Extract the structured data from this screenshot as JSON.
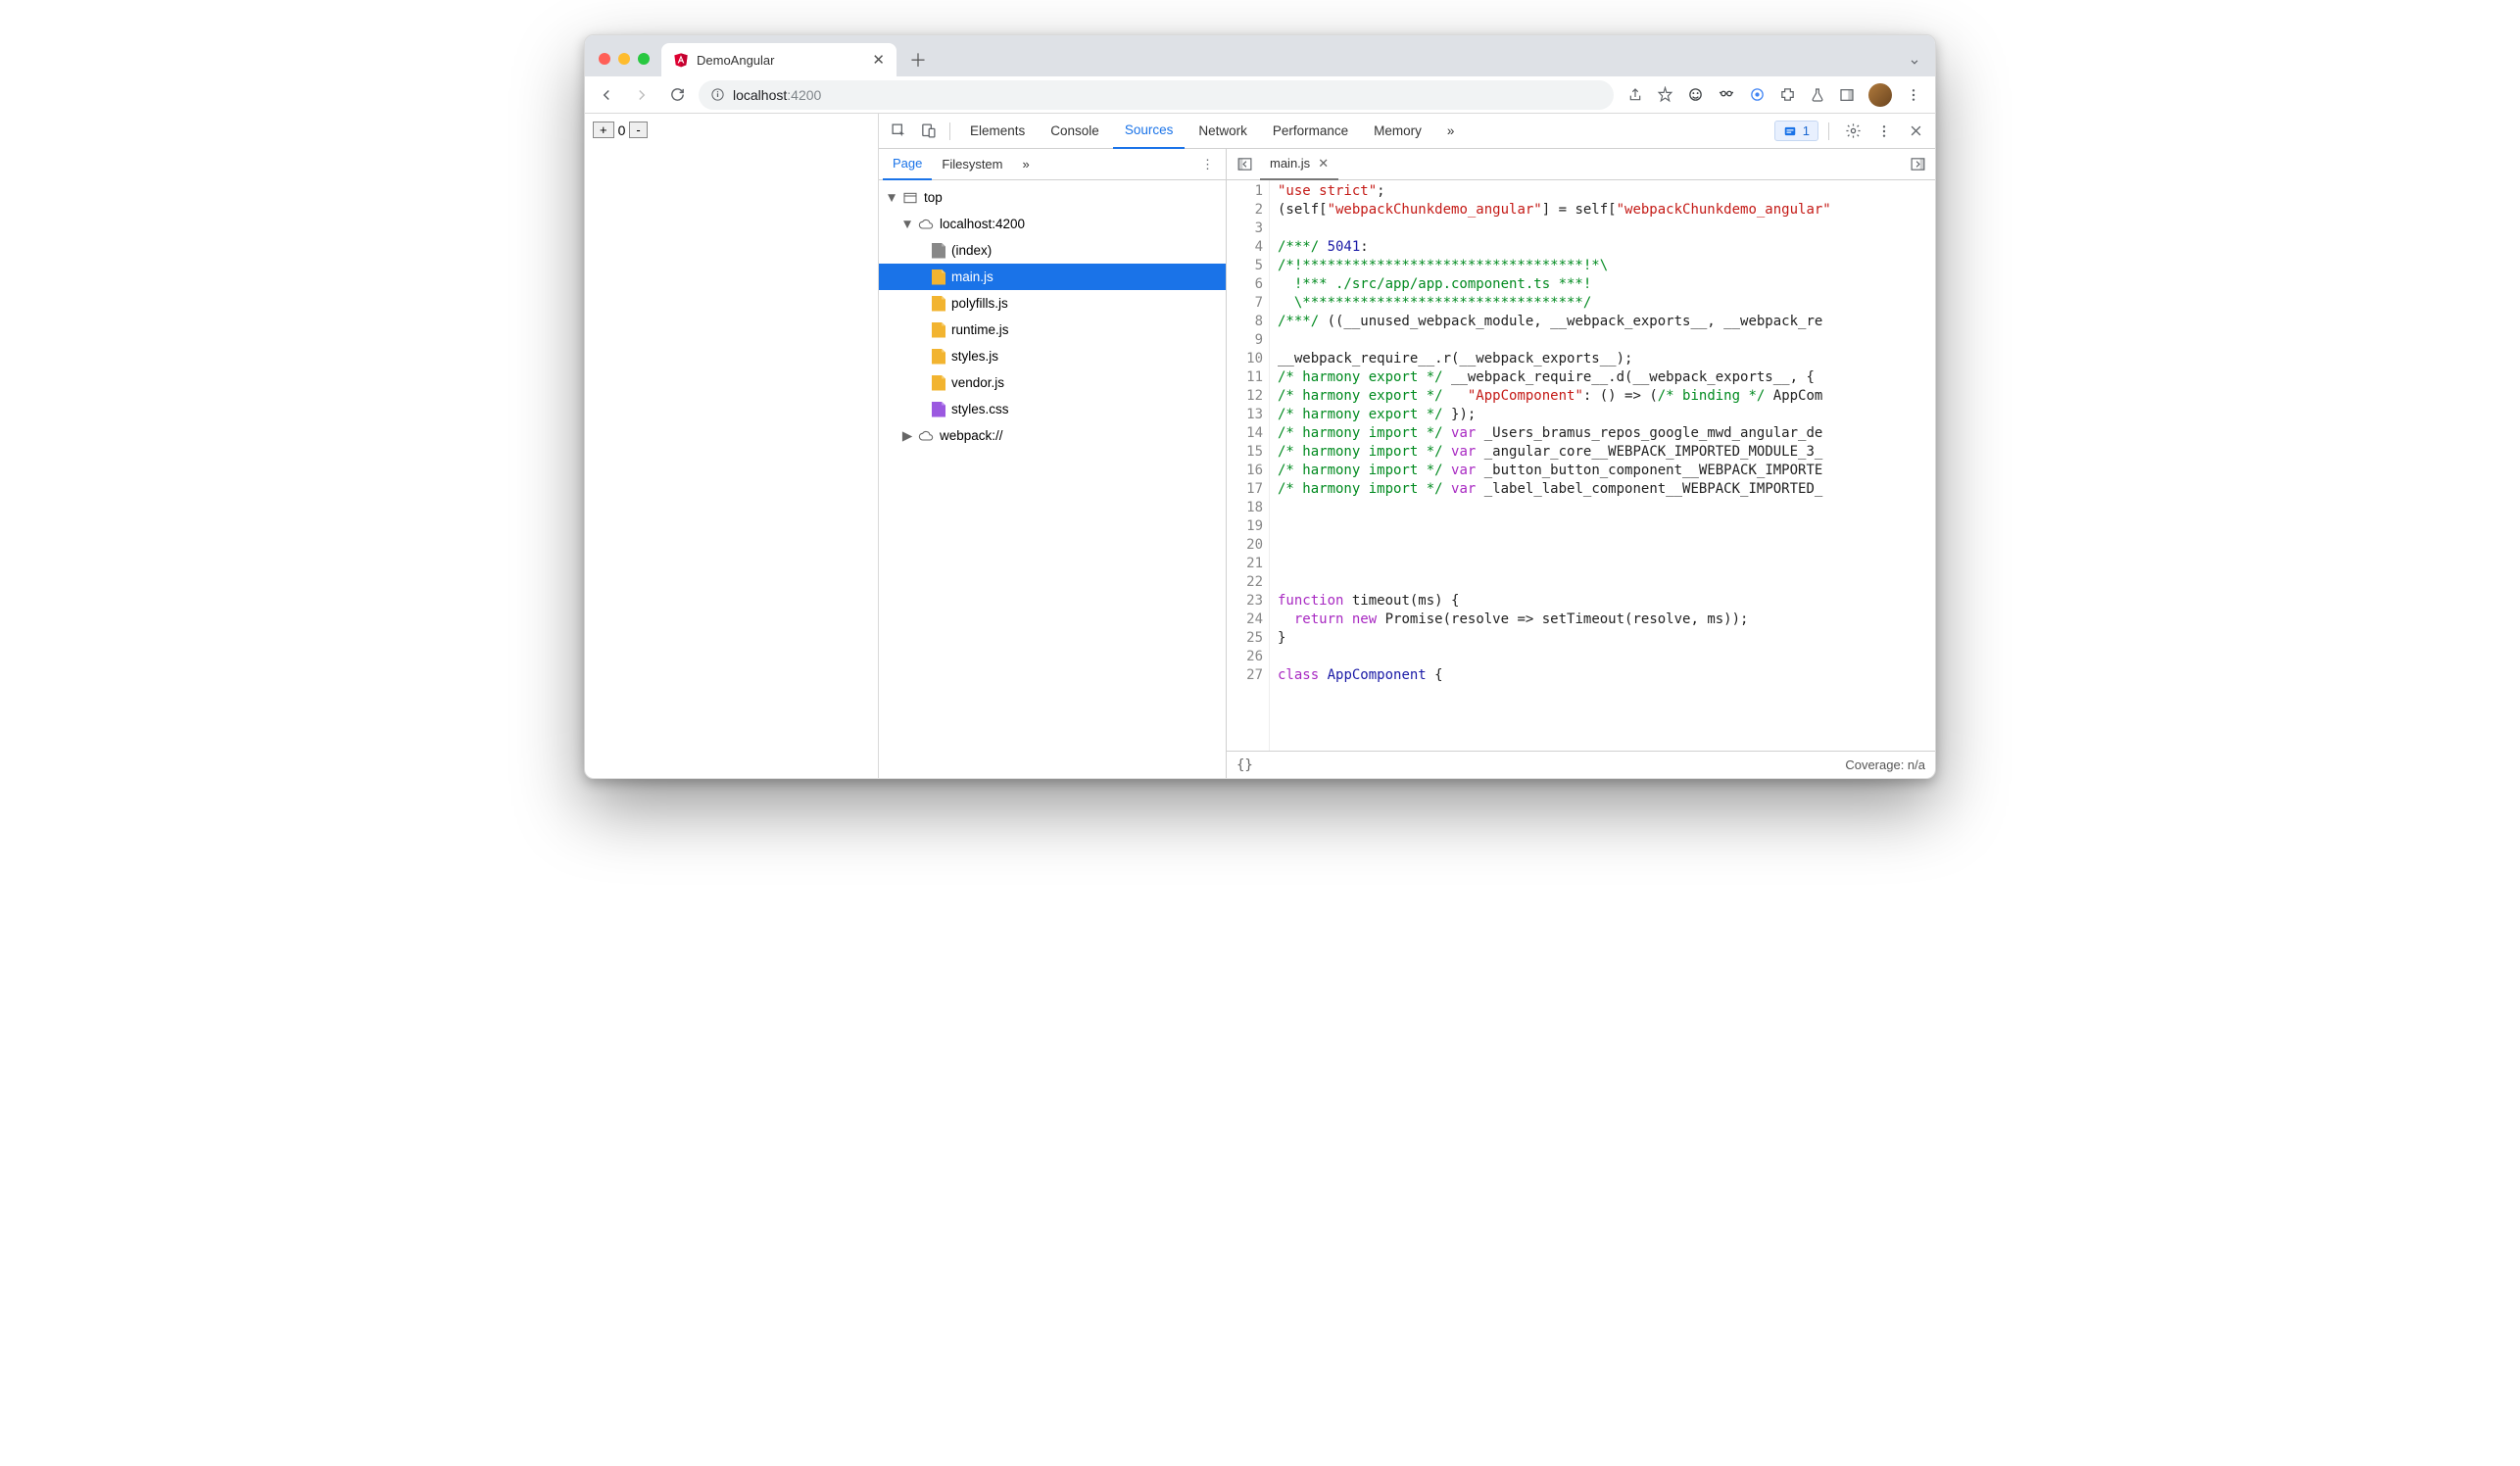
{
  "browser": {
    "tab_title": "DemoAngular",
    "url_host": "localhost",
    "url_port": ":4200"
  },
  "page": {
    "plus": "+",
    "value": "0",
    "minus": "-"
  },
  "devtools": {
    "tabs": [
      "Elements",
      "Console",
      "Sources",
      "Network",
      "Performance",
      "Memory"
    ],
    "active_tab": "Sources",
    "overflow": "»",
    "issue_count": "1",
    "left": {
      "subtabs": [
        "Page",
        "Filesystem"
      ],
      "active": "Page",
      "tree": {
        "top": "top",
        "origin": "localhost:4200",
        "files": [
          {
            "name": "(index)",
            "type": "file"
          },
          {
            "name": "main.js",
            "type": "js",
            "selected": true
          },
          {
            "name": "polyfills.js",
            "type": "js"
          },
          {
            "name": "runtime.js",
            "type": "js"
          },
          {
            "name": "styles.js",
            "type": "js"
          },
          {
            "name": "vendor.js",
            "type": "js"
          },
          {
            "name": "styles.css",
            "type": "css"
          }
        ],
        "webpack": "webpack://"
      }
    },
    "editor": {
      "open_file": "main.js",
      "lines": [
        {
          "n": 1,
          "seg": [
            [
              "str",
              "\"use strict\""
            ],
            [
              "p",
              ";"
            ]
          ]
        },
        {
          "n": 2,
          "seg": [
            [
              "p",
              "(self["
            ],
            [
              "str",
              "\"webpackChunkdemo_angular\""
            ],
            [
              "p",
              "] = self["
            ],
            [
              "str",
              "\"webpackChunkdemo_angular\""
            ]
          ]
        },
        {
          "n": 3,
          "seg": []
        },
        {
          "n": 4,
          "seg": [
            [
              "cmt",
              "/***/ "
            ],
            [
              "num",
              "5041"
            ],
            [
              "p",
              ":"
            ]
          ]
        },
        {
          "n": 5,
          "seg": [
            [
              "cmt",
              "/*!**********************************!*\\"
            ]
          ]
        },
        {
          "n": 6,
          "seg": [
            [
              "cmt",
              "  !*** ./src/app/app.component.ts ***!"
            ]
          ]
        },
        {
          "n": 7,
          "seg": [
            [
              "cmt",
              "  \\**********************************/"
            ]
          ]
        },
        {
          "n": 8,
          "seg": [
            [
              "cmt",
              "/***/ "
            ],
            [
              "p",
              "((__unused_webpack_module, __webpack_exports__, __webpack_re"
            ]
          ]
        },
        {
          "n": 9,
          "seg": []
        },
        {
          "n": 10,
          "seg": [
            [
              "p",
              "__webpack_require__.r(__webpack_exports__);"
            ]
          ]
        },
        {
          "n": 11,
          "seg": [
            [
              "cmt",
              "/* harmony export */ "
            ],
            [
              "p",
              "__webpack_require__.d(__webpack_exports__, {"
            ]
          ]
        },
        {
          "n": 12,
          "seg": [
            [
              "cmt",
              "/* harmony export */   "
            ],
            [
              "str",
              "\"AppComponent\""
            ],
            [
              "p",
              ": () => ("
            ],
            [
              "cmt",
              "/* binding */ "
            ],
            [
              "p",
              "AppCom"
            ]
          ]
        },
        {
          "n": 13,
          "seg": [
            [
              "cmt",
              "/* harmony export */ "
            ],
            [
              "p",
              "});"
            ]
          ]
        },
        {
          "n": 14,
          "seg": [
            [
              "cmt",
              "/* harmony import */ "
            ],
            [
              "kw",
              "var"
            ],
            [
              "p",
              " _Users_bramus_repos_google_mwd_angular_de"
            ]
          ]
        },
        {
          "n": 15,
          "seg": [
            [
              "cmt",
              "/* harmony import */ "
            ],
            [
              "kw",
              "var"
            ],
            [
              "p",
              " _angular_core__WEBPACK_IMPORTED_MODULE_3_"
            ]
          ]
        },
        {
          "n": 16,
          "seg": [
            [
              "cmt",
              "/* harmony import */ "
            ],
            [
              "kw",
              "var"
            ],
            [
              "p",
              " _button_button_component__WEBPACK_IMPORTE"
            ]
          ]
        },
        {
          "n": 17,
          "seg": [
            [
              "cmt",
              "/* harmony import */ "
            ],
            [
              "kw",
              "var"
            ],
            [
              "p",
              " _label_label_component__WEBPACK_IMPORTED_"
            ]
          ]
        },
        {
          "n": 18,
          "seg": []
        },
        {
          "n": 19,
          "seg": []
        },
        {
          "n": 20,
          "seg": []
        },
        {
          "n": 21,
          "seg": []
        },
        {
          "n": 22,
          "seg": []
        },
        {
          "n": 23,
          "seg": [
            [
              "kw",
              "function"
            ],
            [
              "p",
              " timeout(ms) {"
            ]
          ]
        },
        {
          "n": 24,
          "seg": [
            [
              "p",
              "  "
            ],
            [
              "kw",
              "return"
            ],
            [
              "p",
              " "
            ],
            [
              "kw",
              "new"
            ],
            [
              "p",
              " Promise(resolve => setTimeout(resolve, ms));"
            ]
          ]
        },
        {
          "n": 25,
          "seg": [
            [
              "p",
              "}"
            ]
          ]
        },
        {
          "n": 26,
          "seg": []
        },
        {
          "n": 27,
          "seg": [
            [
              "kw",
              "class"
            ],
            [
              "p",
              " "
            ],
            [
              "ident",
              "AppComponent"
            ],
            [
              "p",
              " {"
            ]
          ]
        }
      ]
    },
    "status": {
      "format": "{}",
      "coverage": "Coverage: n/a"
    }
  }
}
